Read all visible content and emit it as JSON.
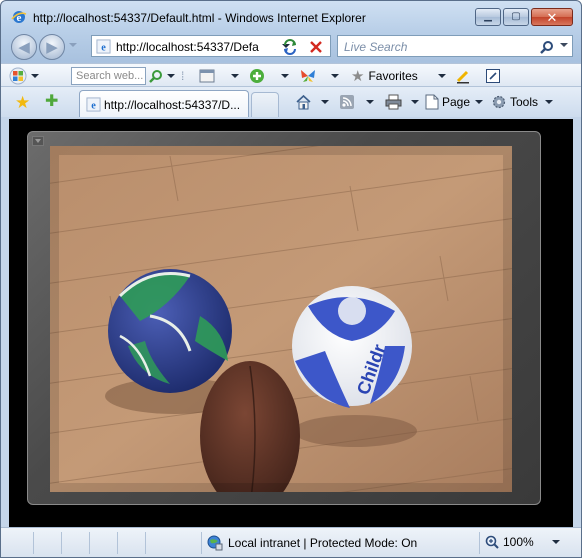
{
  "window": {
    "title": "http://localhost:54337/Default.html - Windows Internet Explorer"
  },
  "address_bar": {
    "url": "http://localhost:54337/Defa"
  },
  "live_search": {
    "placeholder": "Live Search"
  },
  "links_toolbar": {
    "search_placeholder": "Search web...",
    "favorites_label": "Favorites"
  },
  "tabs": [
    {
      "label": "http://localhost:54337/D..."
    }
  ],
  "command_bar": {
    "page_label": "Page",
    "tools_label": "Tools"
  },
  "status_bar": {
    "zone_text": "Local intranet | Protected Mode: On",
    "zoom": "100%"
  },
  "colors": {
    "chrome_blue": "#b9cfe8",
    "close_red": "#c2432a",
    "player_gray": "#4a4a4a"
  },
  "icons": [
    "ie-icon",
    "minimize-icon",
    "maximize-icon",
    "close-icon",
    "back-icon",
    "forward-icon",
    "refresh-icon",
    "stop-icon",
    "search-icon",
    "favorites-star-icon",
    "add-favorite-icon",
    "home-icon",
    "feeds-icon",
    "print-icon",
    "page-icon",
    "tools-gear-icon",
    "globe-icon",
    "zoom-icon"
  ]
}
